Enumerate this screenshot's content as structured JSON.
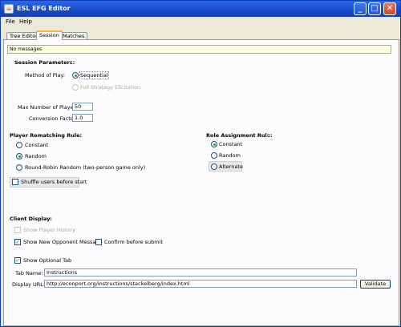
{
  "window": {
    "title": "ESL EFG Editor"
  },
  "menu": {
    "file": "File",
    "help": "Help"
  },
  "tabs": [
    "Tree Editor",
    "Session",
    "Matches"
  ],
  "message": "No messages",
  "session": {
    "heading": "Session Parameters:",
    "method_label": "Method of Play:",
    "method_options": [
      "Sequential",
      "Full Strategy Elicitation"
    ],
    "max_players_label": "Max Number of Players:",
    "max_players_value": "50",
    "conversion_label": "Conversion Factor:",
    "conversion_value": "1.0"
  },
  "rematching": {
    "heading": "Player Rematching Rule:",
    "options": [
      "Constant",
      "Random",
      "Round-Robin Random (two-person game only)"
    ],
    "selected": "Random",
    "shuffle_label": "Shuffle users before start"
  },
  "role": {
    "heading": "Role Assignment Rule:",
    "options": [
      "Constant",
      "Random",
      "Alternate"
    ],
    "selected": "Constant"
  },
  "client": {
    "heading": "Client Display:",
    "show_history": "Show Player History",
    "show_opponent": "Show New Opponent Message",
    "confirm": "Confirm before submit",
    "show_optional_tab": "Show Optional Tab",
    "tab_name_label": "Tab Name:",
    "tab_name_value": "Instructions",
    "display_url_label": "Display URL:",
    "display_url_value": "http://econport.org/instructions/stackelberg/index.html",
    "validate_label": "Validate"
  },
  "icons": [
    "app-icon",
    "minimize-icon",
    "maximize-icon",
    "close-icon"
  ]
}
